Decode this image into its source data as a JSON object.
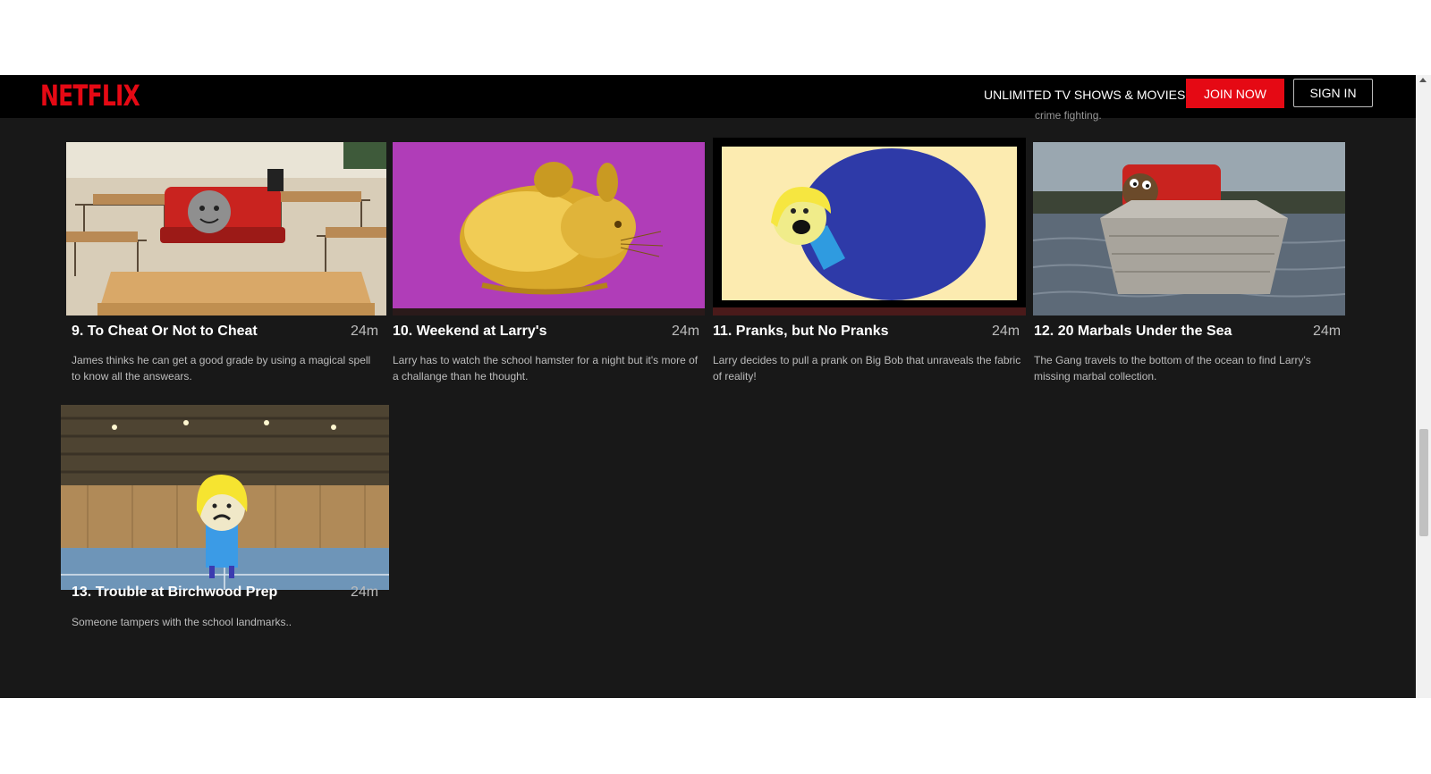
{
  "header": {
    "logo": "NETFLIX",
    "tagline": "UNLIMITED TV SHOWS & MOVIES",
    "join_label": "JOIN NOW",
    "signin_label": "SIGN IN",
    "partial_text": "crime fighting."
  },
  "episodes": [
    {
      "title": "9. To Cheat Or Not to Cheat",
      "duration": "24m",
      "description": "James thinks he can get a good grade by using a magical spell to know all the answears."
    },
    {
      "title": "10. Weekend at Larry's",
      "duration": "24m",
      "description": "Larry has to watch the school hamster for a night but it's more of a challange than he thought."
    },
    {
      "title": "11. Pranks, but No Pranks",
      "duration": "24m",
      "description": "Larry decides to pull a prank on Big Bob that unraveals the fabric of reality!"
    },
    {
      "title": "12. 20 Marbals Under the Sea",
      "duration": "24m",
      "description": "The Gang travels to the bottom of the ocean to find Larry's missing marbal collection."
    },
    {
      "title": "13. Trouble at Birchwood Prep",
      "duration": "24m",
      "description": "Someone tampers with the school landmarks.."
    }
  ],
  "colors": {
    "brand": "#e50914",
    "background": "#181818",
    "topbar": "#000000"
  }
}
